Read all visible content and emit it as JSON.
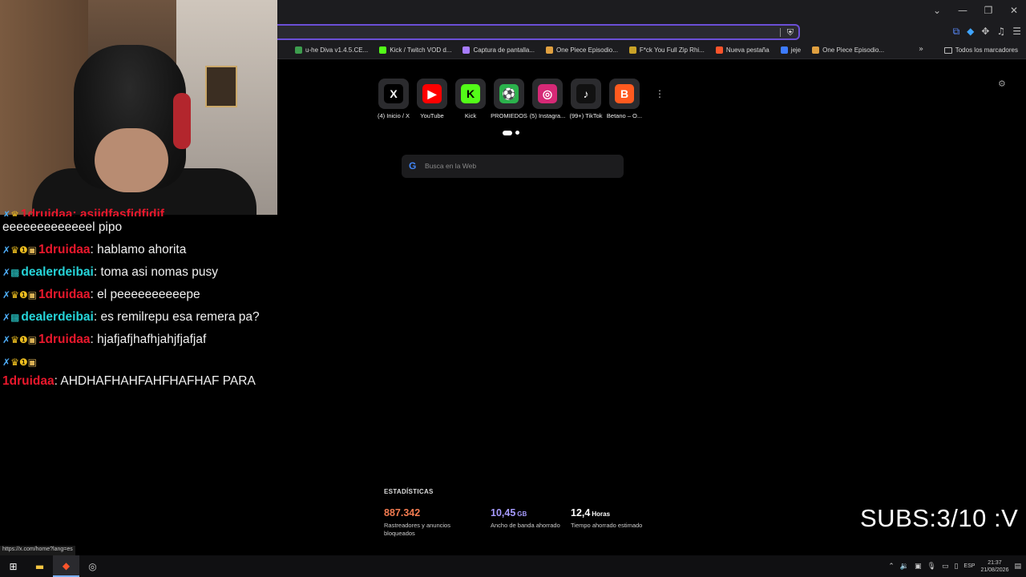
{
  "browser": {
    "window_controls": [
      "⌄",
      "—",
      "❐",
      "✕"
    ],
    "toolbar_icons": [
      "translate-icon",
      "extension-a-icon",
      "puzzle-icon",
      "media-icon",
      "menu-icon"
    ]
  },
  "bookmarks": {
    "items": [
      {
        "label": "u-he Diva v1.4.5.CE...",
        "icon": "#3d9d4e"
      },
      {
        "label": "Kick / Twitch VOD d...",
        "icon": "#53fc18"
      },
      {
        "label": "Captura de pantalla...",
        "icon": "#a77cff"
      },
      {
        "label": "One Piece Episodio...",
        "icon": "#e0a040"
      },
      {
        "label": "F*ck You Full Zip Rhi...",
        "icon": "#c9a227"
      },
      {
        "label": "Nueva pestaña",
        "icon": "#fb542b"
      },
      {
        "label": "jeje",
        "icon": "#3d7bff"
      },
      {
        "label": "One Piece Episodio...",
        "icon": "#e0a040"
      }
    ],
    "more": "»",
    "all_label": "Todos los marcadores"
  },
  "chat": {
    "cut_line": "1druidaa: asjjdfasfjdfjdjf",
    "messages": [
      {
        "user": "",
        "text": "eeeeeeeeeeeeel pipo",
        "type": "continuation"
      },
      {
        "user": "1druidaa",
        "text": ": hablamo ahorita",
        "type": "red"
      },
      {
        "user": "dealerdeibai",
        "text": ": toma asi nomas pusy",
        "type": "cyan"
      },
      {
        "user": "1druidaa",
        "text": ": el peeeeeeeeeepe",
        "type": "red"
      },
      {
        "user": "dealerdeibai",
        "text": ": es remilrepu esa remera pa?",
        "type": "cyan"
      },
      {
        "user": "1druidaa",
        "text": ": hjafjafjhafhjahjfjafjaf",
        "type": "red"
      },
      {
        "user": "1druidaa",
        "text": ": AHDHAFHAHFAHFHAFHAF PARA",
        "type": "red-wrap"
      }
    ]
  },
  "speed_dial": [
    {
      "label": "(4) Inicio / X",
      "glyph": "X",
      "bg": "#000000"
    },
    {
      "label": "YouTube",
      "glyph": "▶",
      "bg": "#ff0000"
    },
    {
      "label": "Kick",
      "glyph": "K",
      "bg": "#53fc18"
    },
    {
      "label": "PROMIEDOS",
      "glyph": "⚽",
      "bg": "#2bb24c"
    },
    {
      "label": "(5) Instagra...",
      "glyph": "◎",
      "bg": "#d62976"
    },
    {
      "label": "(99+) TikTok",
      "glyph": "♪",
      "bg": "#111111"
    },
    {
      "label": "Betano – O...",
      "glyph": "B",
      "bg": "#ff5a1f"
    }
  ],
  "search": {
    "placeholder": "Busca en la Web",
    "engine_glyph": "G"
  },
  "stats": {
    "title": "ESTADÍSTICAS",
    "items": [
      {
        "value": "887.342",
        "unit": "",
        "desc": "Rastreadores y anuncios bloqueados",
        "color": "#f27b50"
      },
      {
        "value": "10,45",
        "unit": "GB",
        "desc": "Ancho de banda ahorrado",
        "color": "#a79bff"
      },
      {
        "value": "12,4",
        "unit": "Horas",
        "desc": "Tiempo ahorrado estimado",
        "color": "#ffffff"
      }
    ]
  },
  "overlay": {
    "subs_text": "SUBS:3/10 :V",
    "status_url": "https://x.com/home?lang=es"
  },
  "taskbar": {
    "lang": "ESP",
    "time": "21:37",
    "date": "21/08/2026"
  }
}
